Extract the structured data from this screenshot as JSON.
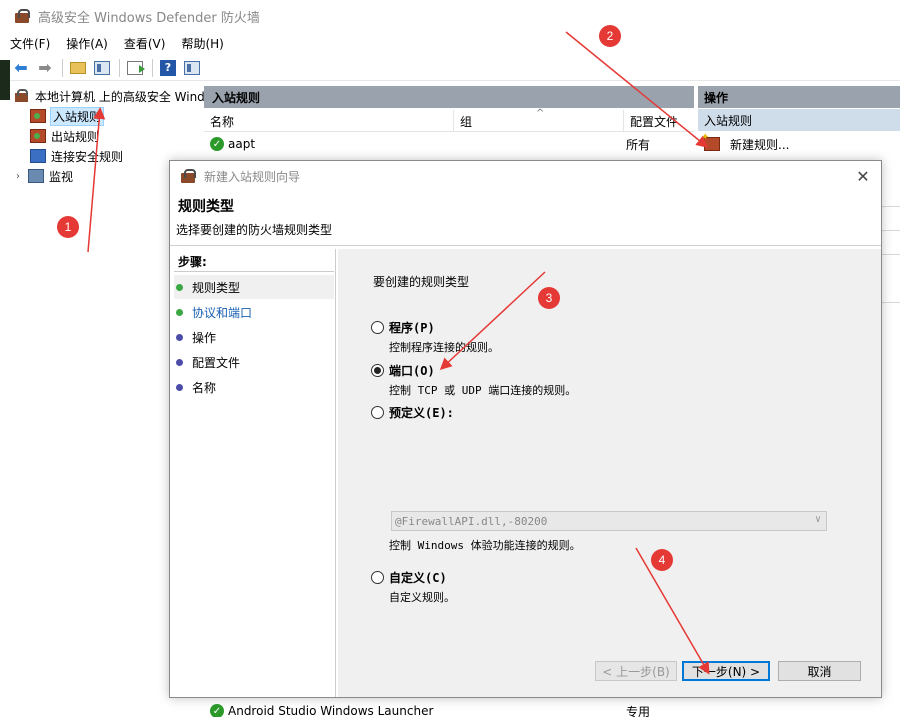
{
  "window": {
    "title": "高级安全 Windows Defender 防火墙"
  },
  "menu": [
    "文件(F)",
    "操作(A)",
    "查看(V)",
    "帮助(H)"
  ],
  "tree": {
    "root": "本地计算机 上的高级安全 Wind",
    "items": [
      "入站规则",
      "出站规则",
      "连接安全规则",
      "监视"
    ]
  },
  "center": {
    "header": "入站规则",
    "columns": [
      "名称",
      "组",
      "配置文件"
    ],
    "rows": [
      {
        "name": "aapt",
        "profile": "所有"
      },
      {
        "name": "Android Studio Windows Launcher",
        "profile": "专用"
      }
    ]
  },
  "actions": {
    "header": "操作",
    "section": "入站规则",
    "new_rule": "新建规则..."
  },
  "dialog": {
    "title": "新建入站规则向导",
    "heading": "规则类型",
    "subheading": "选择要创建的防火墙规则类型",
    "steps_label": "步骤:",
    "steps": [
      "规则类型",
      "协议和端口",
      "操作",
      "配置文件",
      "名称"
    ],
    "prompt": "要创建的规则类型",
    "options": [
      {
        "label": "程序(P)",
        "desc": "控制程序连接的规则。",
        "selected": false
      },
      {
        "label": "端口(O)",
        "desc": "控制 TCP 或 UDP 端口连接的规则。",
        "selected": true
      },
      {
        "label": "预定义(E):",
        "desc": "控制 Windows 体验功能连接的规则。",
        "selected": false
      },
      {
        "label": "自定义(C)",
        "desc": "自定义规则。",
        "selected": false
      }
    ],
    "predefined_value": "@FirewallAPI.dll,-80200",
    "buttons": {
      "back": "< 上一步(B)",
      "next": "下一步(N) >",
      "cancel": "取消"
    }
  },
  "annotations": [
    "1",
    "2",
    "3",
    "4"
  ],
  "colors": {
    "annotation": "#e53935",
    "header_gray": "#9aa3ad",
    "selection": "#cce8ff",
    "step_active": "#39a843",
    "step_pending": "#4b4ba8"
  }
}
